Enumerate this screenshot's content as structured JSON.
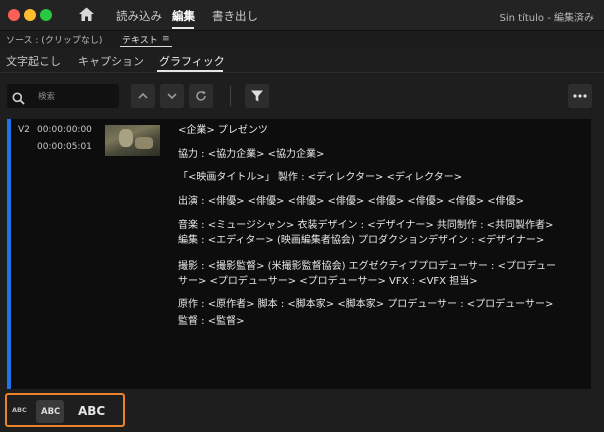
{
  "window": {
    "title": "Sin título - 編集済み",
    "traffic_colors": [
      "#fe5f57",
      "#febc2e",
      "#28c840"
    ]
  },
  "top_menu": {
    "items": [
      "読み込み",
      "編集",
      "書き出し"
    ],
    "active": "編集"
  },
  "source_bar": {
    "source": "ソース : (クリップなし)",
    "tab": "テキスト",
    "tab_menu_icon": "≡"
  },
  "sub_tabs": {
    "items": [
      "文字起こし",
      "キャプション",
      "グラフィック"
    ],
    "active": "グラフィック"
  },
  "toolbar": {
    "search_placeholder": "検索",
    "icons": [
      "search-icon",
      "chevron-up-icon",
      "chevron-down-icon",
      "refresh-icon",
      "filter-icon",
      "more-icon"
    ]
  },
  "graphic_item": {
    "track": "V2",
    "timecode_in": "00:00:00:00",
    "timecode_out": "00:00:05:01",
    "accent_color": "#1e73e8",
    "credits": [
      "<企業> プレゼンツ",
      "協力 : <協力企業> <協力企業>",
      "「<映画タイトル>」 製作 : <ディレクター> <ディレクター>",
      "出演 : <俳優> <俳優> <俳優> <俳優> <俳優> <俳優> <俳優> <俳優>",
      "音楽 : <ミュージシャン> 衣装デザイン : <デザイナー> 共同制作 : <共同製作者>",
      "編集 : <エディター> (映画編集者協会) プロダクションデザイン : <デザイナー>",
      "撮影 : <撮影監督> (米撮影監督協会) エグゼクティブプロデューサー : <プロデュー",
      "サー> <プロデューサー> <プロデューサー> VFX : <VFX 担当>",
      "原作 : <原作者> 脚本 : <脚本家> <脚本家> プロデューサー : <プロデューサー>",
      "監督 : <監督>"
    ]
  },
  "text_size_options": {
    "items": [
      "ABC",
      "ABC",
      "ABC"
    ],
    "selected_index": 1,
    "highlight_color": "#e8832a"
  }
}
